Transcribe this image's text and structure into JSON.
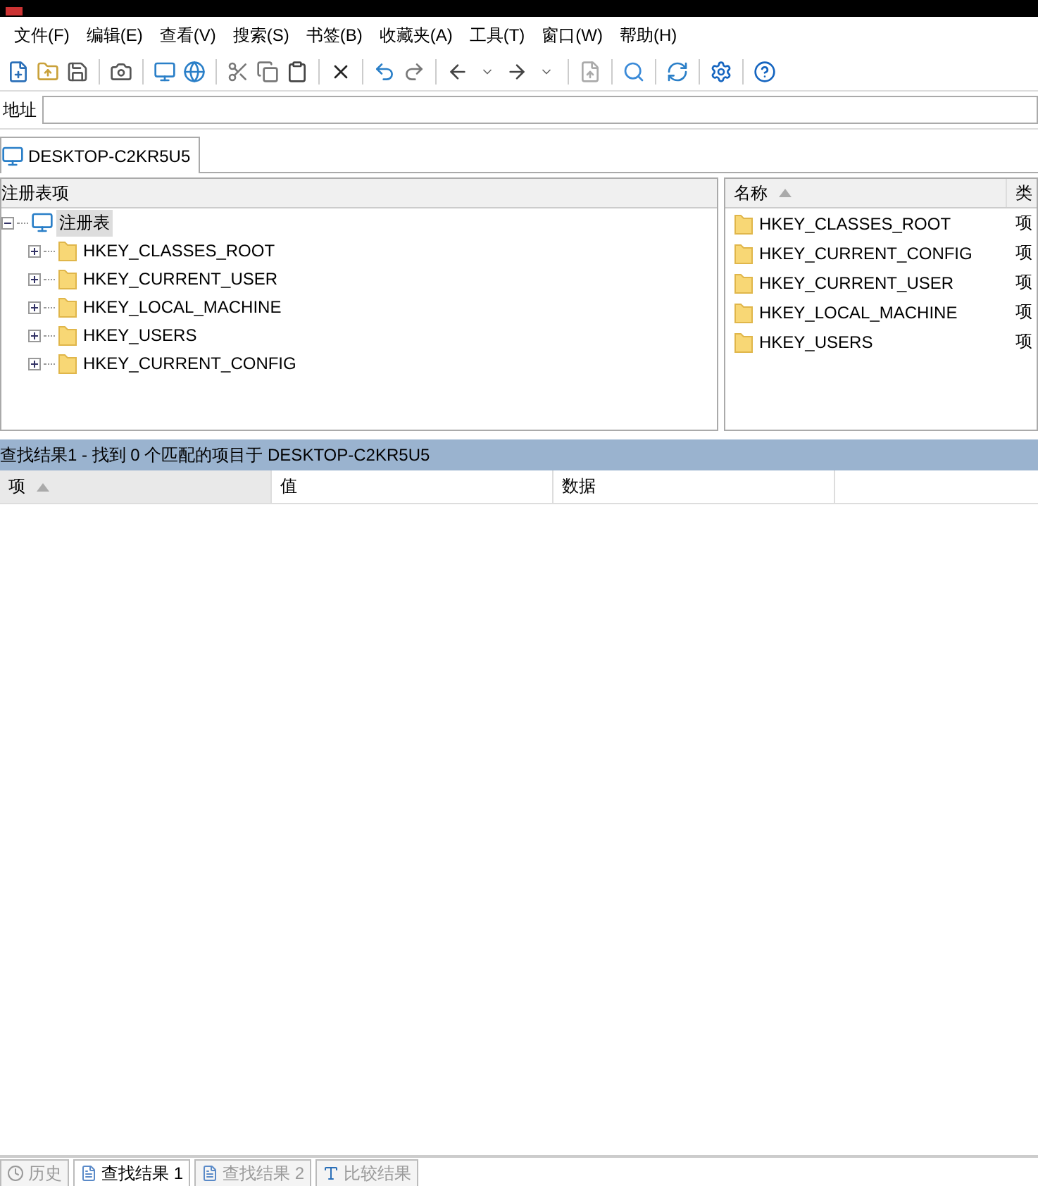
{
  "menu": [
    "文件(F)",
    "编辑(E)",
    "查看(V)",
    "搜索(S)",
    "书签(B)",
    "收藏夹(A)",
    "工具(T)",
    "窗口(W)",
    "帮助(H)"
  ],
  "address": {
    "label": "地址"
  },
  "tabs": [
    {
      "label": "DESKTOP-C2KR5U5",
      "selected": true
    }
  ],
  "tree": {
    "header": "注册表项",
    "root": {
      "label": "注册表",
      "expanded": true,
      "selected": true,
      "children": [
        {
          "label": "HKEY_CLASSES_ROOT",
          "expanded": false
        },
        {
          "label": "HKEY_CURRENT_USER",
          "expanded": false
        },
        {
          "label": "HKEY_LOCAL_MACHINE",
          "expanded": false
        },
        {
          "label": "HKEY_USERS",
          "expanded": false
        },
        {
          "label": "HKEY_CURRENT_CONFIG",
          "expanded": false
        }
      ]
    }
  },
  "list": {
    "sorted_ascending": true,
    "columns": [
      "名称",
      "类"
    ],
    "rows": [
      {
        "name": "HKEY_CLASSES_ROOT",
        "column_2": "项"
      },
      {
        "name": "HKEY_CURRENT_CONFIG",
        "column_2": "项"
      },
      {
        "name": "HKEY_CURRENT_USER",
        "column_2": "项"
      },
      {
        "name": "HKEY_LOCAL_MACHINE",
        "column_2": "项"
      },
      {
        "name": "HKEY_USERS",
        "column_2": "项"
      }
    ]
  },
  "results": {
    "status": "查找结果1 - 找到 0 个匹配的项目于 DESKTOP-C2KR5U5",
    "columns": [
      {
        "label": "项",
        "sorted": true
      },
      {
        "label": "值",
        "sorted": false
      },
      {
        "label": "数据",
        "sorted": false
      }
    ]
  },
  "bottom_tabs": [
    {
      "label": "历史",
      "kind": "history",
      "selected": false
    },
    {
      "label": "查找结果 1",
      "kind": "search",
      "selected": true
    },
    {
      "label": "查找结果 2",
      "kind": "search",
      "selected": false
    },
    {
      "label": "比较结果",
      "kind": "compare",
      "selected": false
    }
  ]
}
